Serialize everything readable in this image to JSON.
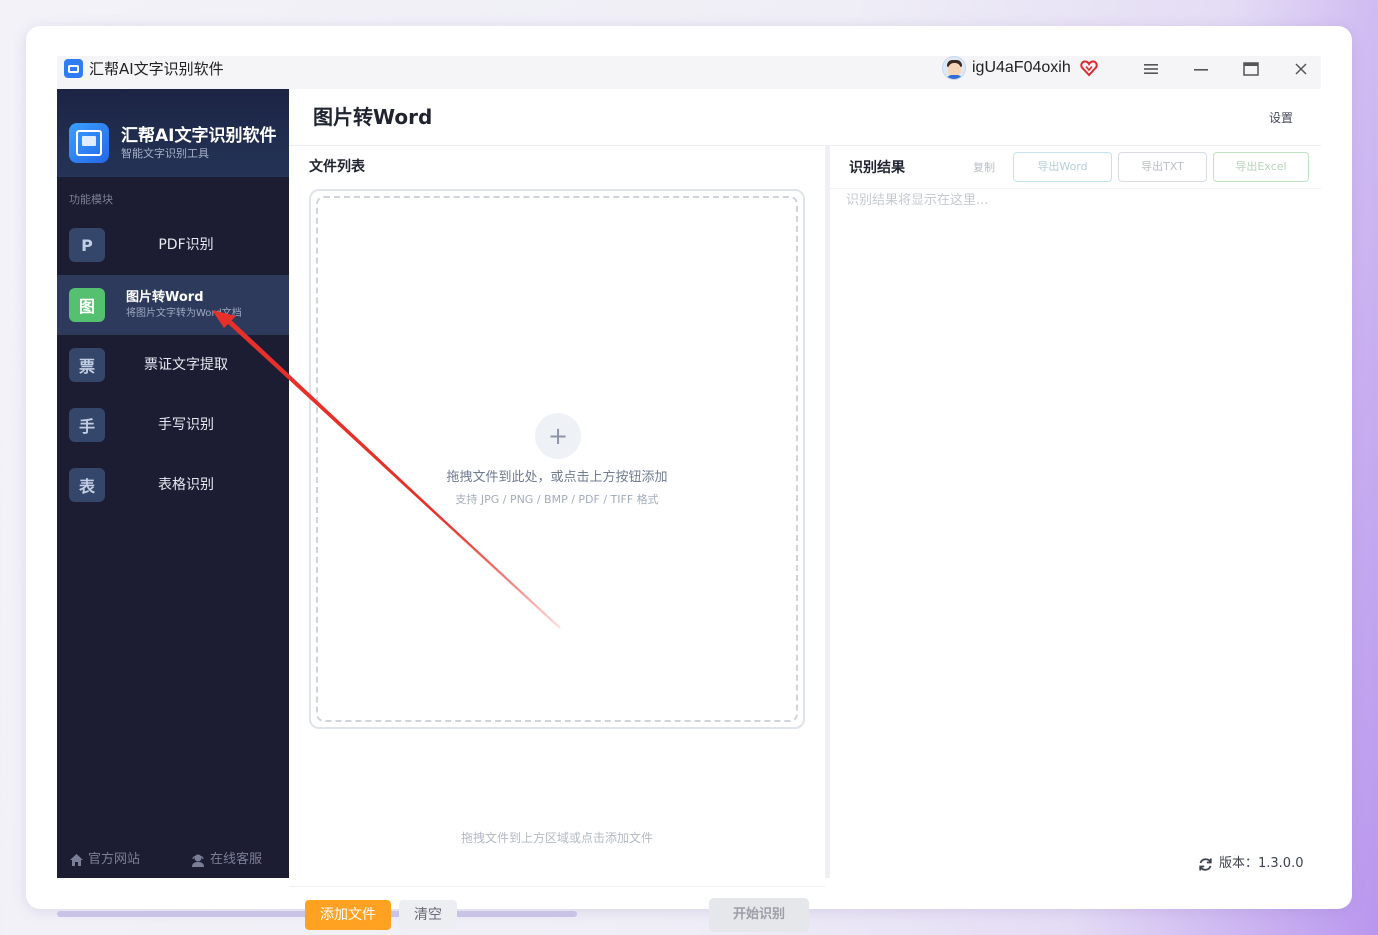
{
  "window": {
    "title": "汇帮AI文字识别软件",
    "username": "igU4aF04oxih"
  },
  "sidebar": {
    "brand_title": "汇帮AI文字识别软件",
    "brand_subtitle": "智能文字识别工具",
    "section_label": "功能模块",
    "items": [
      {
        "badge": "P",
        "label": "PDF识别"
      },
      {
        "badge": "图",
        "label": "图片转Word",
        "subtitle": "将图片文字转为Word文档"
      },
      {
        "badge": "票",
        "label": "票证文字提取"
      },
      {
        "badge": "手",
        "label": "手写识别"
      },
      {
        "badge": "表",
        "label": "表格识别"
      }
    ],
    "footer": {
      "website": "官方网站",
      "service": "在线客服"
    }
  },
  "header": {
    "page_title": "图片转Word",
    "settings": "设置"
  },
  "file_panel": {
    "title": "文件列表",
    "drop_main": "拖拽文件到此处，或点击上方按钮添加",
    "drop_sub": "支持 JPG / PNG / BMP / PDF / TIFF 格式",
    "hint": "拖拽文件到上方区域或点击添加文件",
    "add_button": "添加文件",
    "clear_button": "清空",
    "start_button": "开始识别"
  },
  "result_panel": {
    "title": "识别结果",
    "copy": "复制",
    "export_word": "导出Word",
    "export_txt": "导出TXT",
    "export_excel": "导出Excel",
    "placeholder": "识别结果将显示在这里...",
    "version": "版本：1.3.0.0"
  },
  "colors": {
    "sidebar_bg": "#1c1d33",
    "active_item_bg": "#2d3a5c",
    "active_badge": "#55c070",
    "add_button": "#ffa121",
    "annotation_arrow": "#e8302a"
  }
}
